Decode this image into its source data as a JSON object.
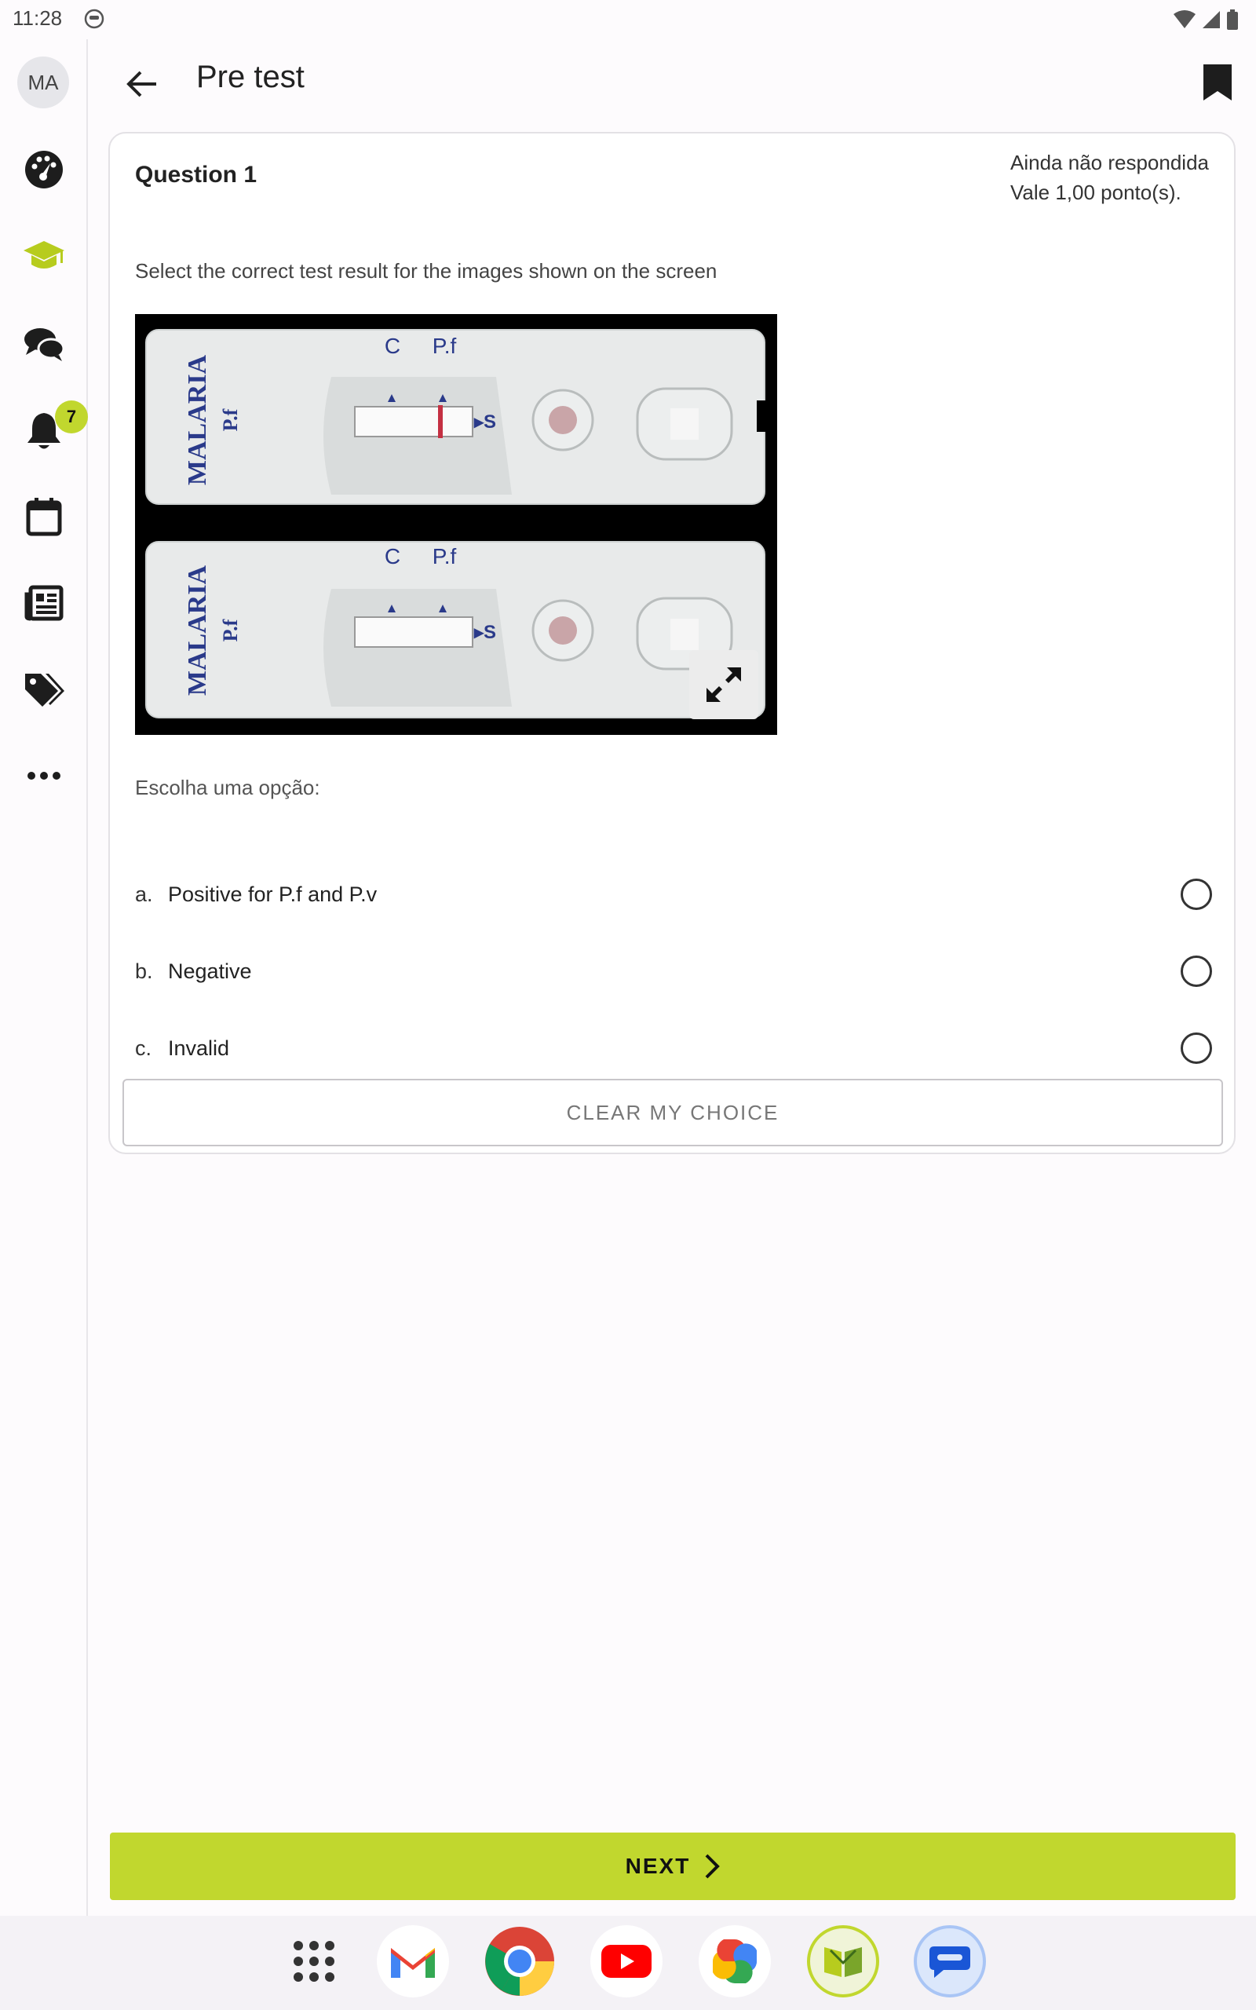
{
  "status_bar": {
    "time": "11:28"
  },
  "rail": {
    "avatar_initials": "MA",
    "items": [
      {
        "icon": "dashboard-icon"
      },
      {
        "icon": "courses-graduation-cap-icon",
        "active": true
      },
      {
        "icon": "messages-icon"
      },
      {
        "icon": "notifications-bell-icon",
        "badge": "7"
      },
      {
        "icon": "calendar-icon"
      },
      {
        "icon": "news-icon"
      },
      {
        "icon": "tags-icon"
      },
      {
        "icon": "more-icon"
      }
    ]
  },
  "appbar": {
    "title": "Pre test"
  },
  "question": {
    "title": "Question 1",
    "status_line1": "Ainda não respondida",
    "status_line2": "Vale 1,00 ponto(s).",
    "text": "Select the correct test result for the images shown on the screen",
    "image_labels": {
      "brand": "MALARIA",
      "sub": "P.f",
      "c_label": "C",
      "pf_label": "P.f",
      "s_label": "▸S"
    },
    "choose_label": "Escolha uma opção:",
    "options": [
      {
        "letter": "a.",
        "label": "Positive for P.f and P.v"
      },
      {
        "letter": "b.",
        "label": "Negative"
      },
      {
        "letter": "c.",
        "label": "Invalid"
      }
    ],
    "clear_label": "CLEAR MY CHOICE"
  },
  "footer": {
    "next_label": "NEXT"
  },
  "dock": {
    "apps": [
      "app-drawer-icon",
      "gmail-icon",
      "chrome-icon",
      "youtube-icon",
      "photos-icon",
      "moodle-books-icon",
      "messages-app-icon"
    ]
  },
  "colors": {
    "accent": "#c1d72e",
    "background": "#fdfbfd"
  }
}
